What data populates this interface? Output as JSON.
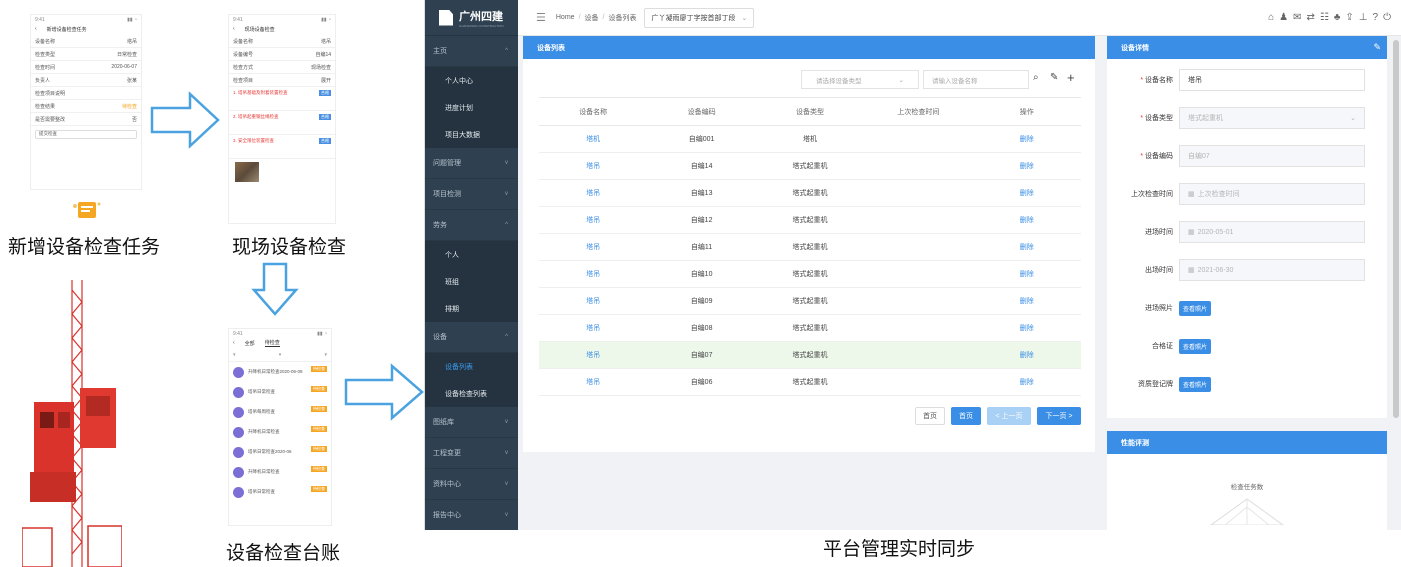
{
  "captions": {
    "new_task": "新增设备检查任务",
    "on_site": "现场设备检查",
    "ledger": "设备检查台账",
    "platform_sync": "平台管理实时同步"
  },
  "phone1": {
    "title": "新增设备检查任务",
    "rows": [
      {
        "label": "设备名称",
        "value": "塔吊"
      },
      {
        "label": "检查类型",
        "value": "日常检查"
      },
      {
        "label": "检查时间",
        "value": "2020-06-07"
      },
      {
        "label": "负责人",
        "value": "张某"
      },
      {
        "label": "检查项目说明",
        "value": ""
      },
      {
        "label": "检查结果",
        "value": "待检查"
      },
      {
        "label": "是否需要整改",
        "value": "否"
      }
    ],
    "submit": "提交检查"
  },
  "phone2": {
    "title": "现场设备检查",
    "rows": [
      {
        "label": "设备名称",
        "value": "塔吊"
      },
      {
        "label": "设备编号",
        "value": "自编14"
      },
      {
        "label": "检查方式",
        "value": "现场检查"
      },
      {
        "label": "检查项目",
        "value": "展开"
      }
    ],
    "items": [
      {
        "text": "1. 塔吊基础及附着装置检查",
        "tag": "合格"
      },
      {
        "text": "2. 塔吊起重钢丝绳检查",
        "tag": "合格"
      },
      {
        "text": "3. 安全限位装置检查",
        "tag": "合格"
      }
    ]
  },
  "phone3": {
    "title": "设备检查台账",
    "tabs": [
      "全部",
      "待检查"
    ],
    "items": [
      {
        "text": "升降机日常检查2020-06-08",
        "tag": "待检查"
      },
      {
        "text": "塔吊日常检查",
        "tag": "待检查"
      },
      {
        "text": "塔吊每周检查",
        "tag": "待检查"
      },
      {
        "text": "升降机日常检查",
        "tag": "待检查"
      },
      {
        "text": "塔吊日常检查2020-06",
        "tag": "待检查"
      },
      {
        "text": "升降机日常检查",
        "tag": "待检查"
      },
      {
        "text": "塔吊日常检查",
        "tag": "待检查"
      }
    ]
  },
  "platform": {
    "logo_name": "广州四建",
    "logo_sub": "GUANGZHOU CONSTRUCTION",
    "breadcrumb": [
      "Home",
      "设备",
      "设备列表"
    ],
    "project": "广丫凝雨廖丁字按首部丁段",
    "sidebar": [
      {
        "type": "group",
        "label": "主页",
        "chev": "^"
      },
      {
        "type": "sub",
        "label": "个人中心"
      },
      {
        "type": "sub",
        "label": "进度计划"
      },
      {
        "type": "sub",
        "label": "项目大数据"
      },
      {
        "type": "group",
        "label": "问题管理",
        "chev": "v"
      },
      {
        "type": "group",
        "label": "项目检测",
        "chev": "v"
      },
      {
        "type": "group",
        "label": "劳务",
        "chev": "^"
      },
      {
        "type": "sub",
        "label": "个人"
      },
      {
        "type": "sub",
        "label": "班组"
      },
      {
        "type": "sub",
        "label": "排期"
      },
      {
        "type": "group",
        "label": "设备",
        "chev": "^"
      },
      {
        "type": "sub",
        "label": "设备列表",
        "active": true
      },
      {
        "type": "sub",
        "label": "设备检查列表"
      },
      {
        "type": "group",
        "label": "图纸库",
        "chev": "v"
      },
      {
        "type": "group",
        "label": "工程变更",
        "chev": "v"
      },
      {
        "type": "group",
        "label": "资料中心",
        "chev": "v"
      },
      {
        "type": "group",
        "label": "报告中心",
        "chev": "v"
      }
    ],
    "list": {
      "title": "设备列表",
      "type_placeholder": "请选择设备类型",
      "name_placeholder": "请输入设备名称",
      "columns": [
        "设备名称",
        "设备编码",
        "设备类型",
        "上次检查时间",
        "操作"
      ],
      "rows": [
        {
          "name": "塔机",
          "code": "自编001",
          "type": "塔机",
          "last": "",
          "op": "删除"
        },
        {
          "name": "塔吊",
          "code": "自编14",
          "type": "塔式起重机",
          "last": "",
          "op": "删除"
        },
        {
          "name": "塔吊",
          "code": "自编13",
          "type": "塔式起重机",
          "last": "",
          "op": "删除"
        },
        {
          "name": "塔吊",
          "code": "自编12",
          "type": "塔式起重机",
          "last": "",
          "op": "删除"
        },
        {
          "name": "塔吊",
          "code": "自编11",
          "type": "塔式起重机",
          "last": "",
          "op": "删除"
        },
        {
          "name": "塔吊",
          "code": "自编10",
          "type": "塔式起重机",
          "last": "",
          "op": "删除"
        },
        {
          "name": "塔吊",
          "code": "自编09",
          "type": "塔式起重机",
          "last": "",
          "op": "删除"
        },
        {
          "name": "塔吊",
          "code": "自编08",
          "type": "塔式起重机",
          "last": "",
          "op": "删除"
        },
        {
          "name": "塔吊",
          "code": "自编07",
          "type": "塔式起重机",
          "last": "",
          "op": "删除"
        },
        {
          "name": "塔吊",
          "code": "自编06",
          "type": "塔式起重机",
          "last": "",
          "op": "删除"
        }
      ],
      "pager": {
        "first": "首页",
        "prev_page": "首页",
        "prev": "< 上一页",
        "next": "下一页 >"
      }
    },
    "detail": {
      "title": "设备详情",
      "fields": [
        {
          "label": "设备名称",
          "value": "塔吊",
          "required": true,
          "kind": "input"
        },
        {
          "label": "设备类型",
          "value": "塔式起重机",
          "required": true,
          "kind": "select"
        },
        {
          "label": "设备编码",
          "value": "自编07",
          "required": true,
          "kind": "disabled"
        },
        {
          "label": "上次检查时间",
          "value": "上次检查时间",
          "required": false,
          "kind": "date"
        },
        {
          "label": "进场时间",
          "value": "2020-05-01",
          "required": false,
          "kind": "date"
        },
        {
          "label": "出场时间",
          "value": "2021-06-30",
          "required": false,
          "kind": "date"
        },
        {
          "label": "进场照片",
          "value": "查看照片",
          "required": false,
          "kind": "button"
        },
        {
          "label": "合格证",
          "value": "查看照片",
          "required": false,
          "kind": "button"
        },
        {
          "label": "资质登记牌",
          "value": "查看照片",
          "required": false,
          "kind": "button"
        }
      ]
    },
    "analysis": {
      "title": "性能评测",
      "chart_label": "检查任务数"
    }
  }
}
